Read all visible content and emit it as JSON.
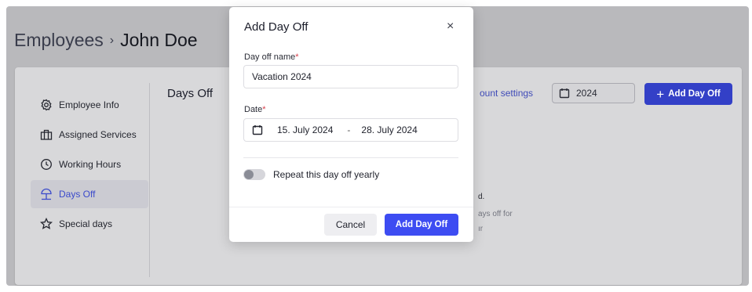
{
  "header": {
    "section": "Employees",
    "separator": "›",
    "employee": "John Doe"
  },
  "sidebar": {
    "items": [
      {
        "label": "Employee Info",
        "icon": "gear-icon"
      },
      {
        "label": "Assigned Services",
        "icon": "services-icon"
      },
      {
        "label": "Working Hours",
        "icon": "clock-icon"
      },
      {
        "label": "Days Off",
        "icon": "beach-umbrella-icon",
        "active": true
      },
      {
        "label": "Special days",
        "icon": "star-icon"
      }
    ]
  },
  "main": {
    "title": "Days Off",
    "discount_link": "ount settings",
    "year": "2024",
    "add_button": "Add Day Off",
    "empty_title": "d.",
    "empty_line1": "ays off for",
    "empty_line2": "ır"
  },
  "modal": {
    "title": "Add Day Off",
    "close": "×",
    "name_label": "Day off name",
    "name_value": "Vacation 2024",
    "date_label": "Date",
    "required_mark": "*",
    "date_start": "15. July 2024",
    "date_sep": "-",
    "date_end": "28. July 2024",
    "repeat_label": "Repeat this day off yearly",
    "repeat_enabled": false,
    "cancel_label": "Cancel",
    "submit_label": "Add Day Off"
  },
  "colors": {
    "accent": "#3d4cf2",
    "required": "#d63e4a",
    "active_nav": "#3b4acb"
  }
}
